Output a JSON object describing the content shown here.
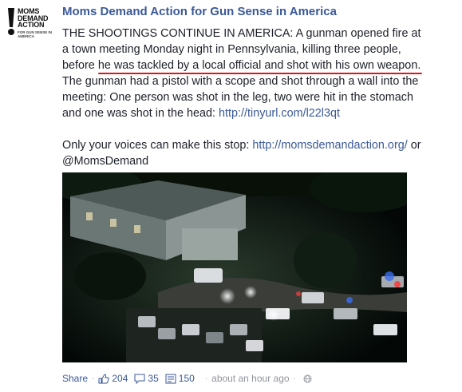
{
  "page": {
    "name": "Moms Demand Action for Gun Sense in America",
    "avatar_title": "MOMS DEMAND ACTION",
    "avatar_sub": "FOR GUN SENSE IN AMERICA"
  },
  "post": {
    "p1_a": "THE SHOOTINGS CONTINUE IN AMERICA: A gunman opened fire at a town meeting Monday night in Pennsylvania, ",
    "p1_hl1": "killing three people, before",
    "p1_hl2": "he was tackled by a local official and shot with his own weapon.",
    "p1_b": " The gunman had a pistol with a scope and shot through a wall into the meeting: One person was shot in the leg, two were hit in the stomach and one was shot in the head: ",
    "p1_link": "http://tinyurl.com/l22l3qt",
    "p2_a": "Only your voices can make this stop: ",
    "p2_link": "http://momsdemandaction.org/",
    "p2_b": " or @MomsDemand"
  },
  "footer": {
    "share_label": "Share",
    "likes": "204",
    "comments": "35",
    "shares": "150",
    "timestamp": "about an hour ago"
  },
  "colors": {
    "link": "#3b5998",
    "underline": "#e0141c",
    "meta": "#90949c"
  },
  "icons": [
    "like-icon",
    "comment-icon",
    "share-icon",
    "globe-icon",
    "exclamation-logo-icon"
  ]
}
